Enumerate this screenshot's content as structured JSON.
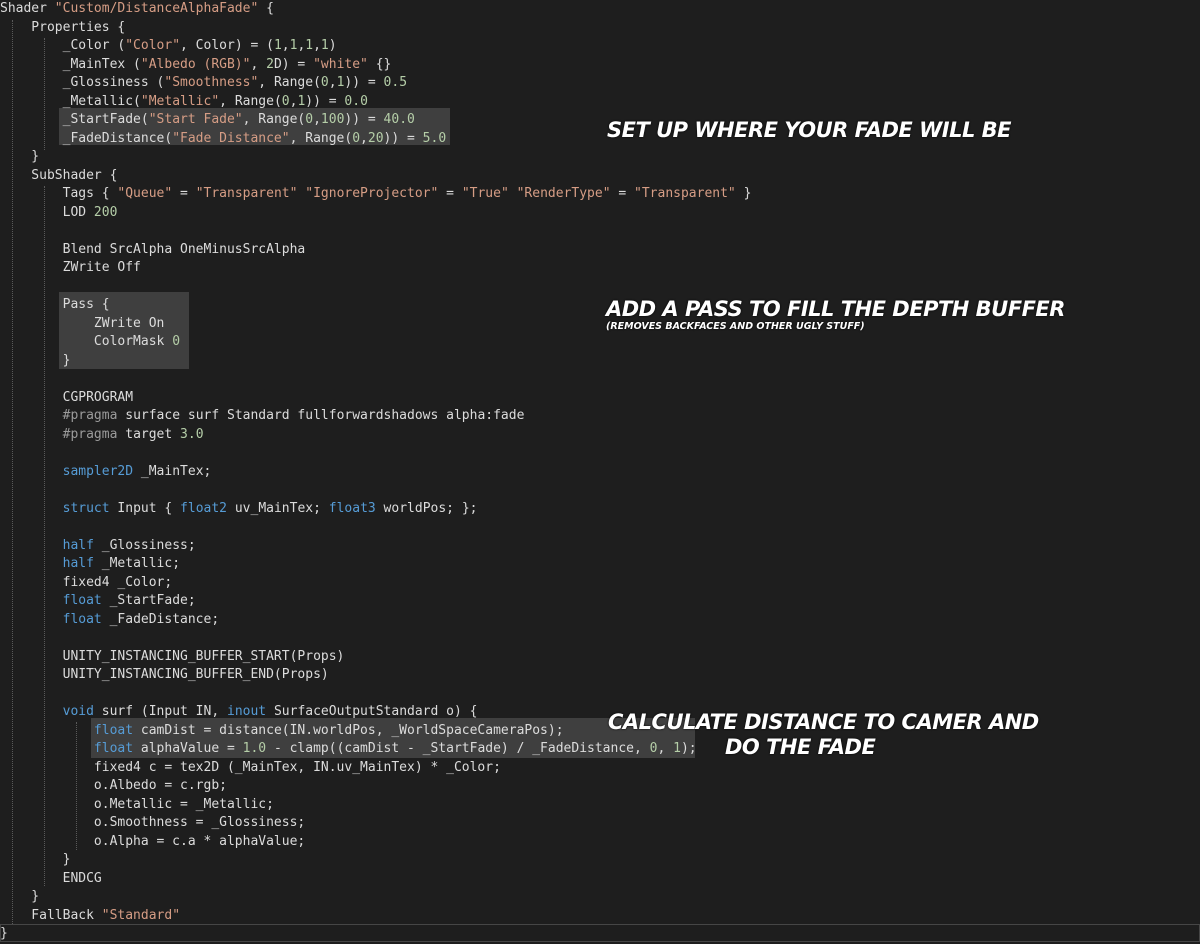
{
  "code_lines": [
    [
      [
        "Shader ",
        ""
      ],
      [
        "\"Custom/DistanceAlphaFade\"",
        "s"
      ],
      [
        " {",
        ""
      ]
    ],
    [
      [
        "    Properties {",
        ""
      ]
    ],
    [
      [
        "        _Color (",
        ""
      ],
      [
        "\"Color\"",
        "s"
      ],
      [
        ", Color) = (",
        ""
      ],
      [
        "1",
        "n"
      ],
      [
        ",",
        ""
      ],
      [
        "1",
        "n"
      ],
      [
        ",",
        ""
      ],
      [
        "1",
        "n"
      ],
      [
        ",",
        ""
      ],
      [
        "1",
        "n"
      ],
      [
        ")",
        ""
      ]
    ],
    [
      [
        "        _MainTex (",
        ""
      ],
      [
        "\"Albedo (RGB)\"",
        "s"
      ],
      [
        ", ",
        ""
      ],
      [
        "2",
        "n"
      ],
      [
        "D) = ",
        ""
      ],
      [
        "\"white\"",
        "s"
      ],
      [
        " {}",
        ""
      ]
    ],
    [
      [
        "        _Glossiness (",
        ""
      ],
      [
        "\"Smoothness\"",
        "s"
      ],
      [
        ", Range(",
        ""
      ],
      [
        "0",
        "n"
      ],
      [
        ",",
        ""
      ],
      [
        "1",
        "n"
      ],
      [
        ")) = ",
        ""
      ],
      [
        "0.5",
        "n"
      ]
    ],
    [
      [
        "        _Metallic(",
        ""
      ],
      [
        "\"Metallic\"",
        "s"
      ],
      [
        ", Range(",
        ""
      ],
      [
        "0",
        "n"
      ],
      [
        ",",
        ""
      ],
      [
        "1",
        "n"
      ],
      [
        ")) = ",
        ""
      ],
      [
        "0.0",
        "n"
      ]
    ],
    [
      [
        "        _StartFade(",
        ""
      ],
      [
        "\"Start Fade\"",
        "s"
      ],
      [
        ", Range(",
        ""
      ],
      [
        "0",
        "n"
      ],
      [
        ",",
        ""
      ],
      [
        "100",
        "n"
      ],
      [
        ")) = ",
        ""
      ],
      [
        "40.0",
        "n"
      ]
    ],
    [
      [
        "        _FadeDistance(",
        ""
      ],
      [
        "\"Fade Distance\"",
        "s"
      ],
      [
        ", Range(",
        ""
      ],
      [
        "0",
        "n"
      ],
      [
        ",",
        ""
      ],
      [
        "20",
        "n"
      ],
      [
        ")) = ",
        ""
      ],
      [
        "5.0",
        "n"
      ]
    ],
    [
      [
        "    }",
        ""
      ]
    ],
    [
      [
        "    SubShader {",
        ""
      ]
    ],
    [
      [
        "        Tags { ",
        ""
      ],
      [
        "\"Queue\"",
        "s"
      ],
      [
        " = ",
        ""
      ],
      [
        "\"Transparent\"",
        "s"
      ],
      [
        " ",
        ""
      ],
      [
        "\"IgnoreProjector\"",
        "s"
      ],
      [
        " = ",
        ""
      ],
      [
        "\"True\"",
        "s"
      ],
      [
        " ",
        ""
      ],
      [
        "\"RenderType\"",
        "s"
      ],
      [
        " = ",
        ""
      ],
      [
        "\"Transparent\"",
        "s"
      ],
      [
        " }",
        ""
      ]
    ],
    [
      [
        "        LOD ",
        ""
      ],
      [
        "200",
        "n"
      ]
    ],
    [
      [
        "",
        ""
      ]
    ],
    [
      [
        "        Blend SrcAlpha OneMinusSrcAlpha",
        ""
      ]
    ],
    [
      [
        "        ZWrite Off",
        ""
      ]
    ],
    [
      [
        "",
        ""
      ]
    ],
    [
      [
        "        Pass {",
        ""
      ]
    ],
    [
      [
        "            ZWrite On",
        ""
      ]
    ],
    [
      [
        "            ColorMask ",
        ""
      ],
      [
        "0",
        "n"
      ]
    ],
    [
      [
        "        }",
        ""
      ]
    ],
    [
      [
        "",
        ""
      ]
    ],
    [
      [
        "        CGPROGRAM",
        ""
      ]
    ],
    [
      [
        "        ",
        ""
      ],
      [
        "#pragma",
        "p"
      ],
      [
        " surface surf Standard fullforwardshadows alpha:fade",
        ""
      ]
    ],
    [
      [
        "        ",
        ""
      ],
      [
        "#pragma",
        "p"
      ],
      [
        " target ",
        ""
      ],
      [
        "3.0",
        "n"
      ]
    ],
    [
      [
        "",
        ""
      ]
    ],
    [
      [
        "        ",
        ""
      ],
      [
        "sampler2D",
        "k"
      ],
      [
        " _MainTex;",
        ""
      ]
    ],
    [
      [
        "",
        ""
      ]
    ],
    [
      [
        "        ",
        ""
      ],
      [
        "struct",
        "k"
      ],
      [
        " Input { ",
        ""
      ],
      [
        "float2",
        "k"
      ],
      [
        " uv_MainTex; ",
        ""
      ],
      [
        "float3",
        "k"
      ],
      [
        " worldPos; };",
        ""
      ]
    ],
    [
      [
        "",
        ""
      ]
    ],
    [
      [
        "        ",
        ""
      ],
      [
        "half",
        "k"
      ],
      [
        " _Glossiness;",
        ""
      ]
    ],
    [
      [
        "        ",
        ""
      ],
      [
        "half",
        "k"
      ],
      [
        " _Metallic;",
        ""
      ]
    ],
    [
      [
        "        fixed4 _Color;",
        ""
      ]
    ],
    [
      [
        "        ",
        ""
      ],
      [
        "float",
        "k"
      ],
      [
        " _StartFade;",
        ""
      ]
    ],
    [
      [
        "        ",
        ""
      ],
      [
        "float",
        "k"
      ],
      [
        " _FadeDistance;",
        ""
      ]
    ],
    [
      [
        "",
        ""
      ]
    ],
    [
      [
        "        UNITY_INSTANCING_BUFFER_START(Props)",
        ""
      ]
    ],
    [
      [
        "        UNITY_INSTANCING_BUFFER_END(Props)",
        ""
      ]
    ],
    [
      [
        "",
        ""
      ]
    ],
    [
      [
        "        ",
        ""
      ],
      [
        "void",
        "k"
      ],
      [
        " surf (Input IN, ",
        ""
      ],
      [
        "inout",
        "k"
      ],
      [
        " SurfaceOutputStandard o) {",
        ""
      ]
    ],
    [
      [
        "            ",
        ""
      ],
      [
        "float",
        "k"
      ],
      [
        " camDist = distance(IN.worldPos, _WorldSpaceCameraPos);",
        ""
      ]
    ],
    [
      [
        "            ",
        ""
      ],
      [
        "float",
        "k"
      ],
      [
        " alphaValue = ",
        ""
      ],
      [
        "1.0",
        "n"
      ],
      [
        " - clamp((camDist - _StartFade) / _FadeDistance, ",
        ""
      ],
      [
        "0",
        "n"
      ],
      [
        ", ",
        ""
      ],
      [
        "1",
        "n"
      ],
      [
        ");",
        ""
      ]
    ],
    [
      [
        "            fixed4 c = tex2D (_MainTex, IN.uv_MainTex) * _Color;",
        ""
      ]
    ],
    [
      [
        "            o.Albedo = c.rgb;",
        ""
      ]
    ],
    [
      [
        "            o.Metallic = _Metallic;",
        ""
      ]
    ],
    [
      [
        "            o.Smoothness = _Glossiness;",
        ""
      ]
    ],
    [
      [
        "            o.Alpha = c.a * alphaValue;",
        ""
      ]
    ],
    [
      [
        "        }",
        ""
      ]
    ],
    [
      [
        "        ENDCG",
        ""
      ]
    ],
    [
      [
        "    }",
        ""
      ]
    ],
    [
      [
        "    FallBack ",
        ""
      ],
      [
        "\"Standard\"",
        "s"
      ]
    ],
    [
      [
        "}",
        ""
      ]
    ]
  ],
  "annotations": {
    "setup_title": "SET UP WHERE YOUR FADE WILL BE",
    "pass_title": "ADD A PASS TO FILL THE DEPTH BUFFER",
    "pass_subtitle": "(REMOVES BACKFACES AND OTHER UGLY STUFF)",
    "calc_line1": "CALCULATE DISTANCE TO CAMER AND",
    "calc_line2": "DO THE FADE"
  },
  "colors": {
    "background": "#1e1e1e",
    "text": "#dcdcdc",
    "string": "#d69d85",
    "keyword": "#569cd6",
    "number": "#b5cea8",
    "preprocessor": "#9b9b9b",
    "highlight": "#3f3f3f"
  }
}
